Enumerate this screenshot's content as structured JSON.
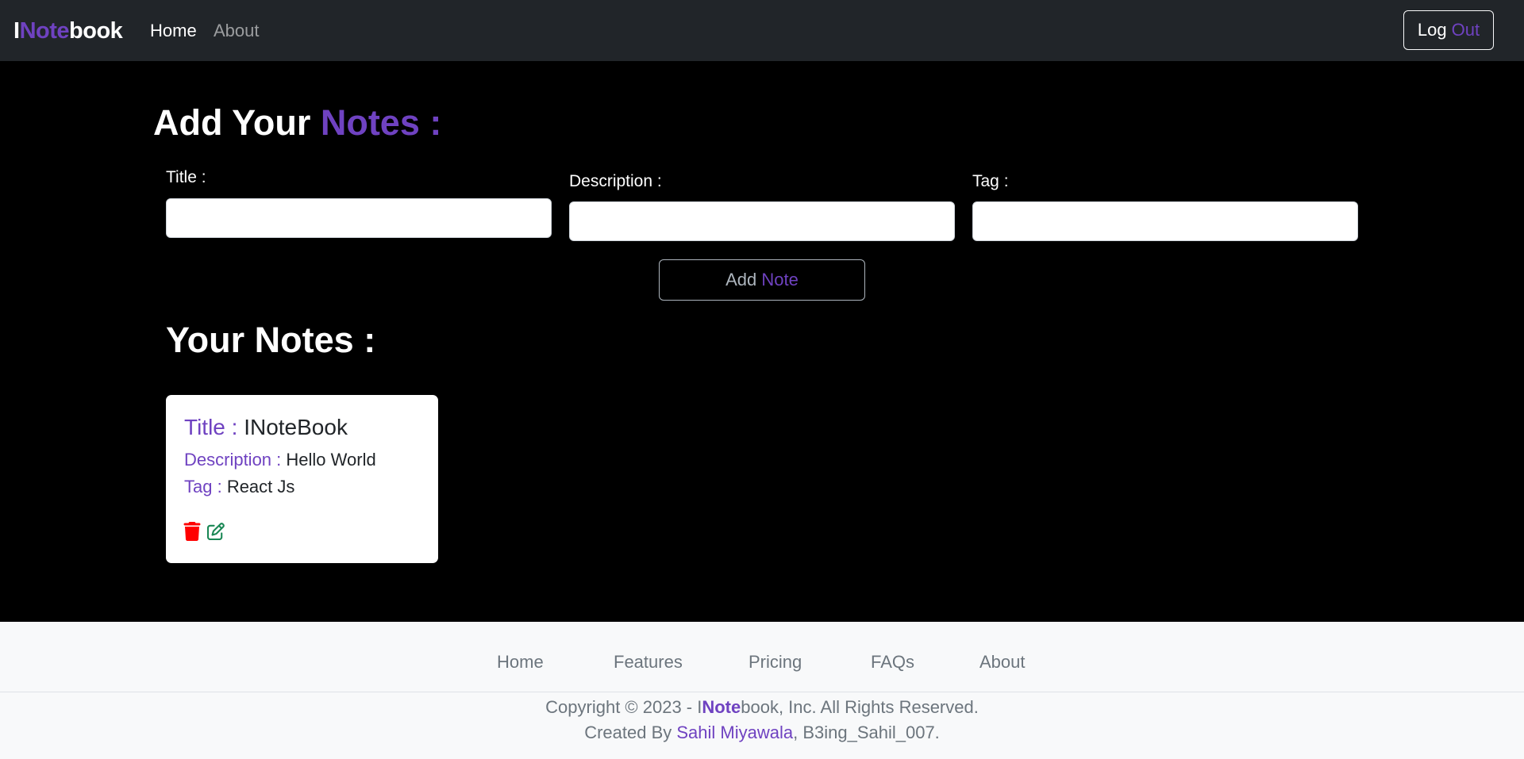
{
  "navbar": {
    "brand": {
      "part1": "I",
      "part2": "Note",
      "part3": "book"
    },
    "links": [
      {
        "label": "Home"
      },
      {
        "label": "About"
      }
    ],
    "logout": {
      "part1": "Log ",
      "part2": "Out"
    }
  },
  "add_note": {
    "heading": {
      "part1": "Add Your ",
      "part2": "Notes :"
    },
    "title_label": "Title :",
    "title_value": "",
    "description_label": "Description :",
    "description_value": "",
    "tag_label": "Tag :",
    "tag_value": "",
    "button": {
      "part1": "Add ",
      "part2": "Note"
    }
  },
  "your_notes": {
    "heading": "Your Notes :",
    "notes": [
      {
        "title_label": "Title : ",
        "title": "INoteBook",
        "description_label": "Description : ",
        "description": "Hello World",
        "tag_label": "Tag : ",
        "tag": "React Js",
        "actions": [
          {
            "icon": "trash-icon",
            "color": "#ff0000"
          },
          {
            "icon": "edit-icon",
            "color": "#198754"
          }
        ]
      }
    ]
  },
  "footer": {
    "links": [
      {
        "label": "Home"
      },
      {
        "label": "Features"
      },
      {
        "label": "Pricing"
      },
      {
        "label": "FAQs"
      },
      {
        "label": "About"
      }
    ],
    "copyright": {
      "prefix": "Copyright © 2023 - I",
      "brand_accent": "Note",
      "suffix": "book, Inc. All Rights Reserved."
    },
    "credit": {
      "prefix": "Created By ",
      "author": "Sahil Miyawala",
      "suffix": ", B3ing_Sahil_007."
    }
  },
  "colors": {
    "accent": "#6f42c1",
    "navbar_bg": "#212529",
    "page_bg": "#000000",
    "footer_bg": "#f8f9fa"
  }
}
